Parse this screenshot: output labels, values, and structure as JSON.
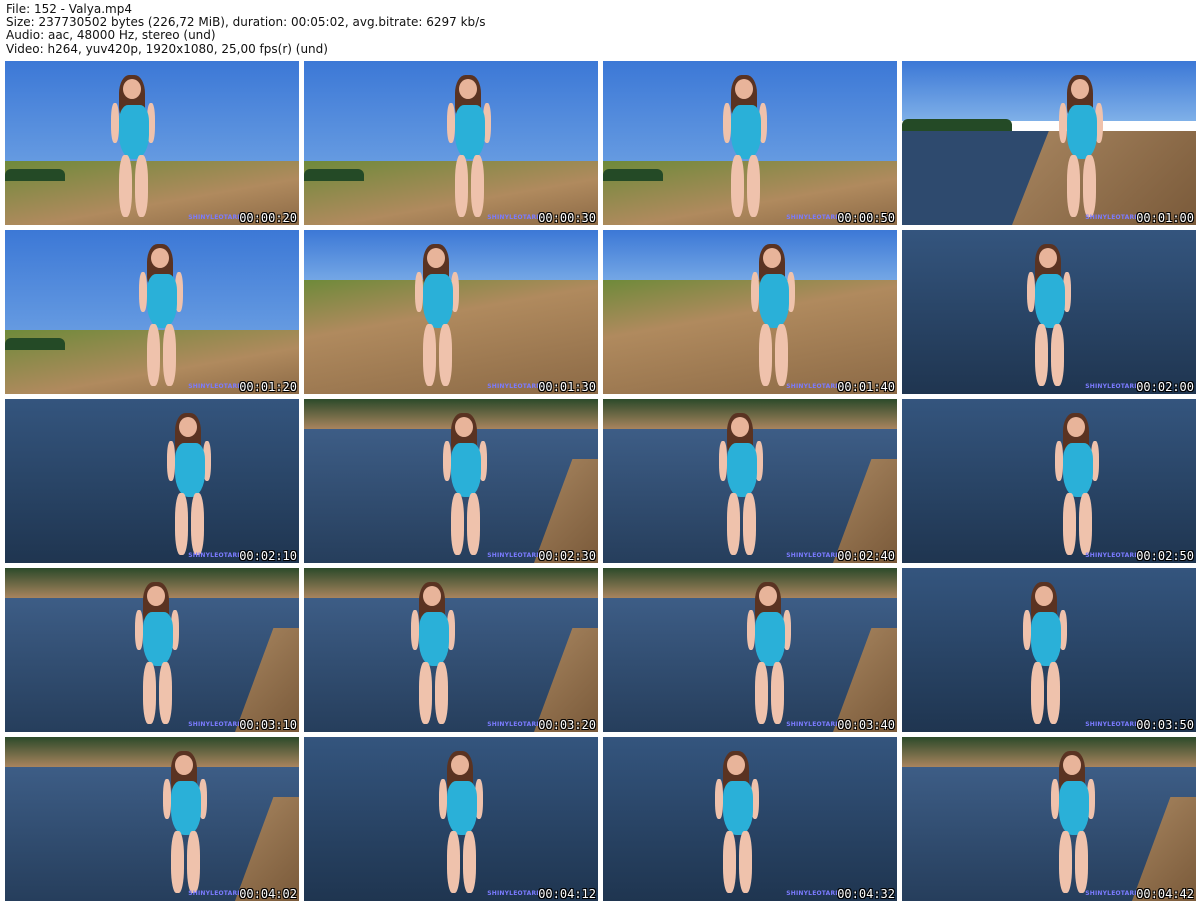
{
  "header": {
    "line1": "File: 152 - Valya.mp4",
    "line2": "Size: 237730502 bytes (226,72 MiB), duration: 00:05:02, avg.bitrate: 6297 kb/s",
    "line3": "Audio: aac, 48000 Hz, stereo (und)",
    "line4": "Video: h264, yuv420p, 1920x1080, 25,00 fps(r) (und)"
  },
  "watermark": "SHINYLEOTARDS",
  "thumbnails": [
    {
      "time": "00:00:20",
      "scene": "sky"
    },
    {
      "time": "00:00:30",
      "scene": "sky"
    },
    {
      "time": "00:00:50",
      "scene": "sky"
    },
    {
      "time": "00:01:00",
      "scene": "shore"
    },
    {
      "time": "00:01:20",
      "scene": "sky"
    },
    {
      "time": "00:01:30",
      "scene": "sand"
    },
    {
      "time": "00:01:40",
      "scene": "sand"
    },
    {
      "time": "00:02:00",
      "scene": "water"
    },
    {
      "time": "00:02:10",
      "scene": "water"
    },
    {
      "time": "00:02:30",
      "scene": "lake"
    },
    {
      "time": "00:02:40",
      "scene": "lake"
    },
    {
      "time": "00:02:50",
      "scene": "water"
    },
    {
      "time": "00:03:10",
      "scene": "lake"
    },
    {
      "time": "00:03:20",
      "scene": "lake"
    },
    {
      "time": "00:03:40",
      "scene": "lake"
    },
    {
      "time": "00:03:50",
      "scene": "water"
    },
    {
      "time": "00:04:02",
      "scene": "lake"
    },
    {
      "time": "00:04:12",
      "scene": "water"
    },
    {
      "time": "00:04:32",
      "scene": "water"
    },
    {
      "time": "00:04:42",
      "scene": "lake"
    }
  ],
  "colors": {
    "sky": "#4f86d8",
    "water": "#2e4a6e",
    "sand": "#9c7a55",
    "grass": "#6e8a3a",
    "suit": "#2ab0d8"
  }
}
